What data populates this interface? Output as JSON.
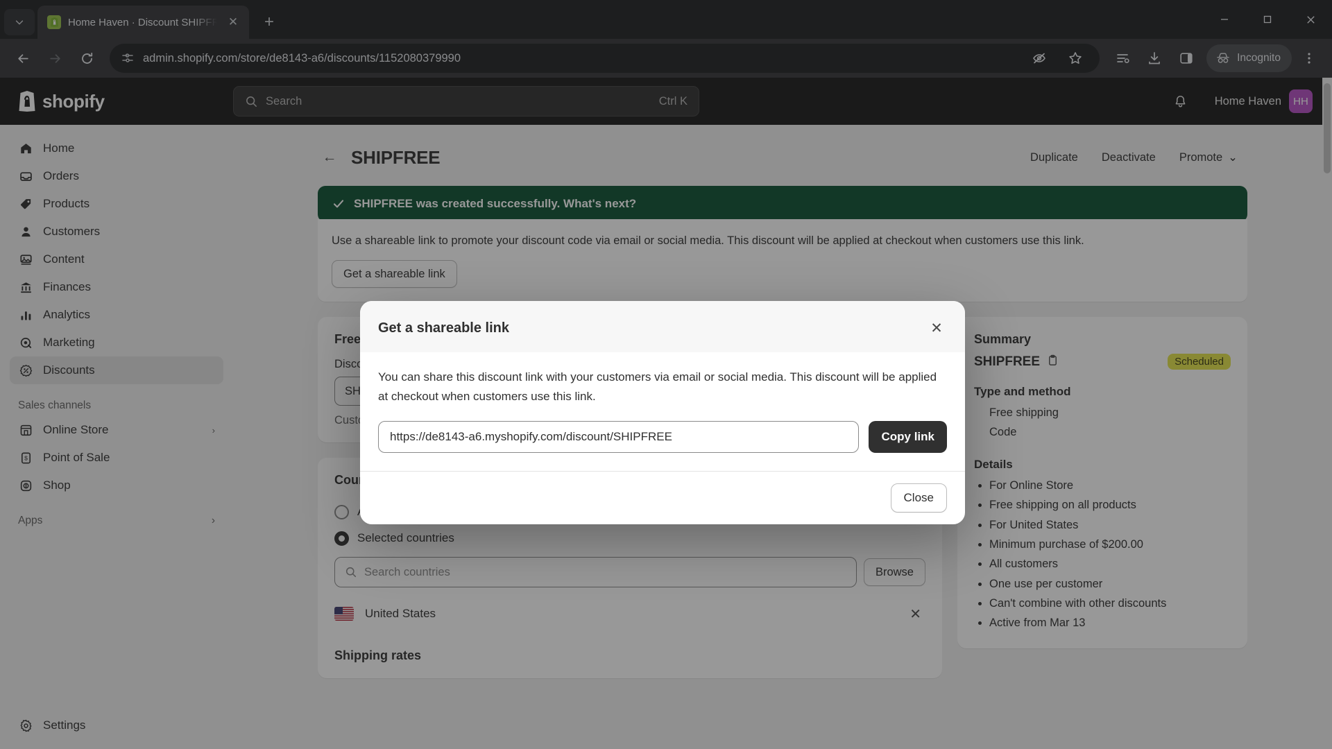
{
  "browser": {
    "tab": {
      "title": "Home Haven · Discount SHIPFR",
      "favicon_icon": "shopify-bag-icon",
      "close_icon": "close-icon"
    },
    "tab_search_icon": "chevron-down-icon",
    "new_tab_icon": "plus-icon",
    "window": {
      "minimize": "—",
      "maximize": "▢",
      "close": "✕"
    },
    "nav": {
      "back_icon": "arrow-left-icon",
      "forward_icon": "arrow-right-icon",
      "reload_icon": "reload-icon"
    },
    "omnibox": {
      "site_info_icon": "page-info-icon",
      "url": "admin.shopify.com/store/de8143-a6/discounts/1152080379990",
      "hidden_icon": "eye-off-icon",
      "bookmark_icon": "star-icon"
    },
    "actions": {
      "tab_list_icon": "tab-list-icon",
      "download_icon": "download-icon",
      "side_panel_icon": "side-panel-icon",
      "incognito_label": "Incognito",
      "incognito_icon": "incognito-icon",
      "menu_icon": "kebab-menu-icon"
    }
  },
  "topbar": {
    "brand": "shopify",
    "search": {
      "placeholder": "Search",
      "icon": "search-icon",
      "shortcut": "Ctrl K"
    },
    "notifications_icon": "bell-icon",
    "store_name": "Home Haven",
    "avatar_initials": "HH"
  },
  "sidebar": {
    "items": [
      {
        "label": "Home",
        "icon": "home-icon",
        "active": false
      },
      {
        "label": "Orders",
        "icon": "orders-icon",
        "active": false
      },
      {
        "label": "Products",
        "icon": "tag-icon",
        "active": false
      },
      {
        "label": "Customers",
        "icon": "person-icon",
        "active": false
      },
      {
        "label": "Content",
        "icon": "image-icon",
        "active": false
      },
      {
        "label": "Finances",
        "icon": "bank-icon",
        "active": false
      },
      {
        "label": "Analytics",
        "icon": "bar-chart-icon",
        "active": false
      },
      {
        "label": "Marketing",
        "icon": "target-icon",
        "active": false
      },
      {
        "label": "Discounts",
        "icon": "discount-icon",
        "active": true
      }
    ],
    "sales_channels_heading": "Sales channels",
    "sales_channels": [
      {
        "label": "Online Store",
        "icon": "storefront-icon"
      },
      {
        "label": "Point of Sale",
        "icon": "pos-icon"
      },
      {
        "label": "Shop",
        "icon": "shop-icon"
      }
    ],
    "apps_heading": "Apps",
    "settings": {
      "label": "Settings",
      "icon": "gear-icon"
    }
  },
  "page": {
    "back_icon": "arrow-left-icon",
    "title": "SHIPFREE",
    "actions": [
      {
        "label": "Duplicate"
      },
      {
        "label": "Deactivate"
      },
      {
        "label": "Promote",
        "caret": "⌄"
      }
    ],
    "banner": {
      "icon": "check-icon",
      "message": "SHIPFREE was created successfully. What's next?",
      "body": "Use a shareable link to promote your discount code via email or social media. This discount will be applied at checkout when customers use this link.",
      "button": "Get a shareable link"
    },
    "method_card": {
      "title": "Free shipping",
      "field_label": "Discount code",
      "code_value": "SHIPFREE",
      "note": "Customers must enter this code at checkout"
    },
    "countries_card": {
      "title": "Countries",
      "options": [
        {
          "label": "All countries",
          "selected": false
        },
        {
          "label": "Selected countries",
          "selected": true
        }
      ],
      "search_placeholder": "Search countries",
      "search_icon": "search-icon",
      "browse_label": "Browse",
      "selected": [
        {
          "name": "United States",
          "flag": "us-flag-icon",
          "remove_icon": "close-icon"
        }
      ]
    },
    "shipping_rates_title": "Shipping rates"
  },
  "summary": {
    "heading": "Summary",
    "code": "SHIPFREE",
    "copy_icon": "clipboard-icon",
    "status_badge": "Scheduled",
    "type_heading": "Type and method",
    "type_items": [
      "Free shipping",
      "Code"
    ],
    "details_heading": "Details",
    "details": [
      "For Online Store",
      "Free shipping on all products",
      "For United States",
      "Minimum purchase of $200.00",
      "All customers",
      "One use per customer",
      "Can't combine with other discounts",
      "Active from Mar 13"
    ]
  },
  "modal": {
    "title": "Get a shareable link",
    "close_icon": "close-icon",
    "body": "You can share this discount link with your customers via email or social media. This discount will be applied at checkout when customers use this link.",
    "link_value": "https://de8143-a6.myshopify.com/discount/SHIPFREE",
    "copy_button": "Copy link",
    "close_button": "Close"
  },
  "colors": {
    "brand_green": "#0c5132",
    "accent_dark": "#303030",
    "badge_yellow": "#e3e34a",
    "avatar_purple": "#b44ec4"
  }
}
